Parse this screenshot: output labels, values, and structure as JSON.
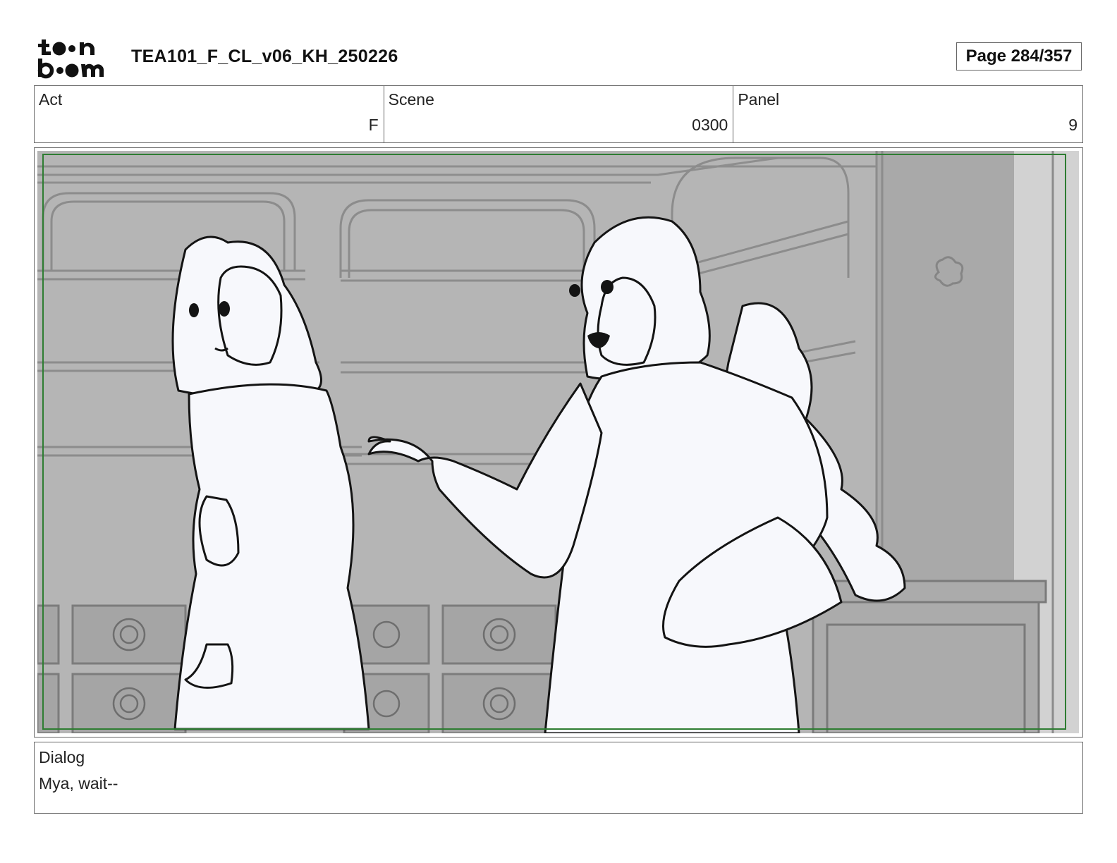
{
  "header": {
    "logo_name": "toon boom",
    "document_title": "TEA101_F_CL_v06_KH_250226",
    "page_indicator": "Page 284/357"
  },
  "info": {
    "act_label": "Act",
    "act_value": "F",
    "scene_label": "Scene",
    "scene_value": "0300",
    "panel_label": "Panel",
    "panel_value": "9"
  },
  "panel": {
    "safe_frame_color": "#2e7d32",
    "background_tone": "#b5b5b5"
  },
  "dialog": {
    "label": "Dialog",
    "text": "Mya, wait--"
  }
}
